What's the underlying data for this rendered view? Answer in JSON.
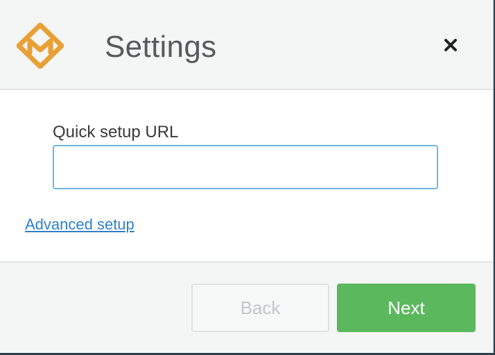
{
  "window": {
    "title": "Settings",
    "logo_icon": "app-logo-icon",
    "close_icon": "close-icon"
  },
  "form": {
    "url_label": "Quick setup URL",
    "url_value": "",
    "url_placeholder": "",
    "advanced_link": "Advanced setup"
  },
  "footer": {
    "back_label": "Back",
    "next_label": "Next"
  },
  "colors": {
    "logo_accent": "#e8a035",
    "next_button": "#5cb85c",
    "input_focus_border": "#6fb6e6",
    "link": "#2e7fd0",
    "header_background": "#f4f5f5"
  }
}
